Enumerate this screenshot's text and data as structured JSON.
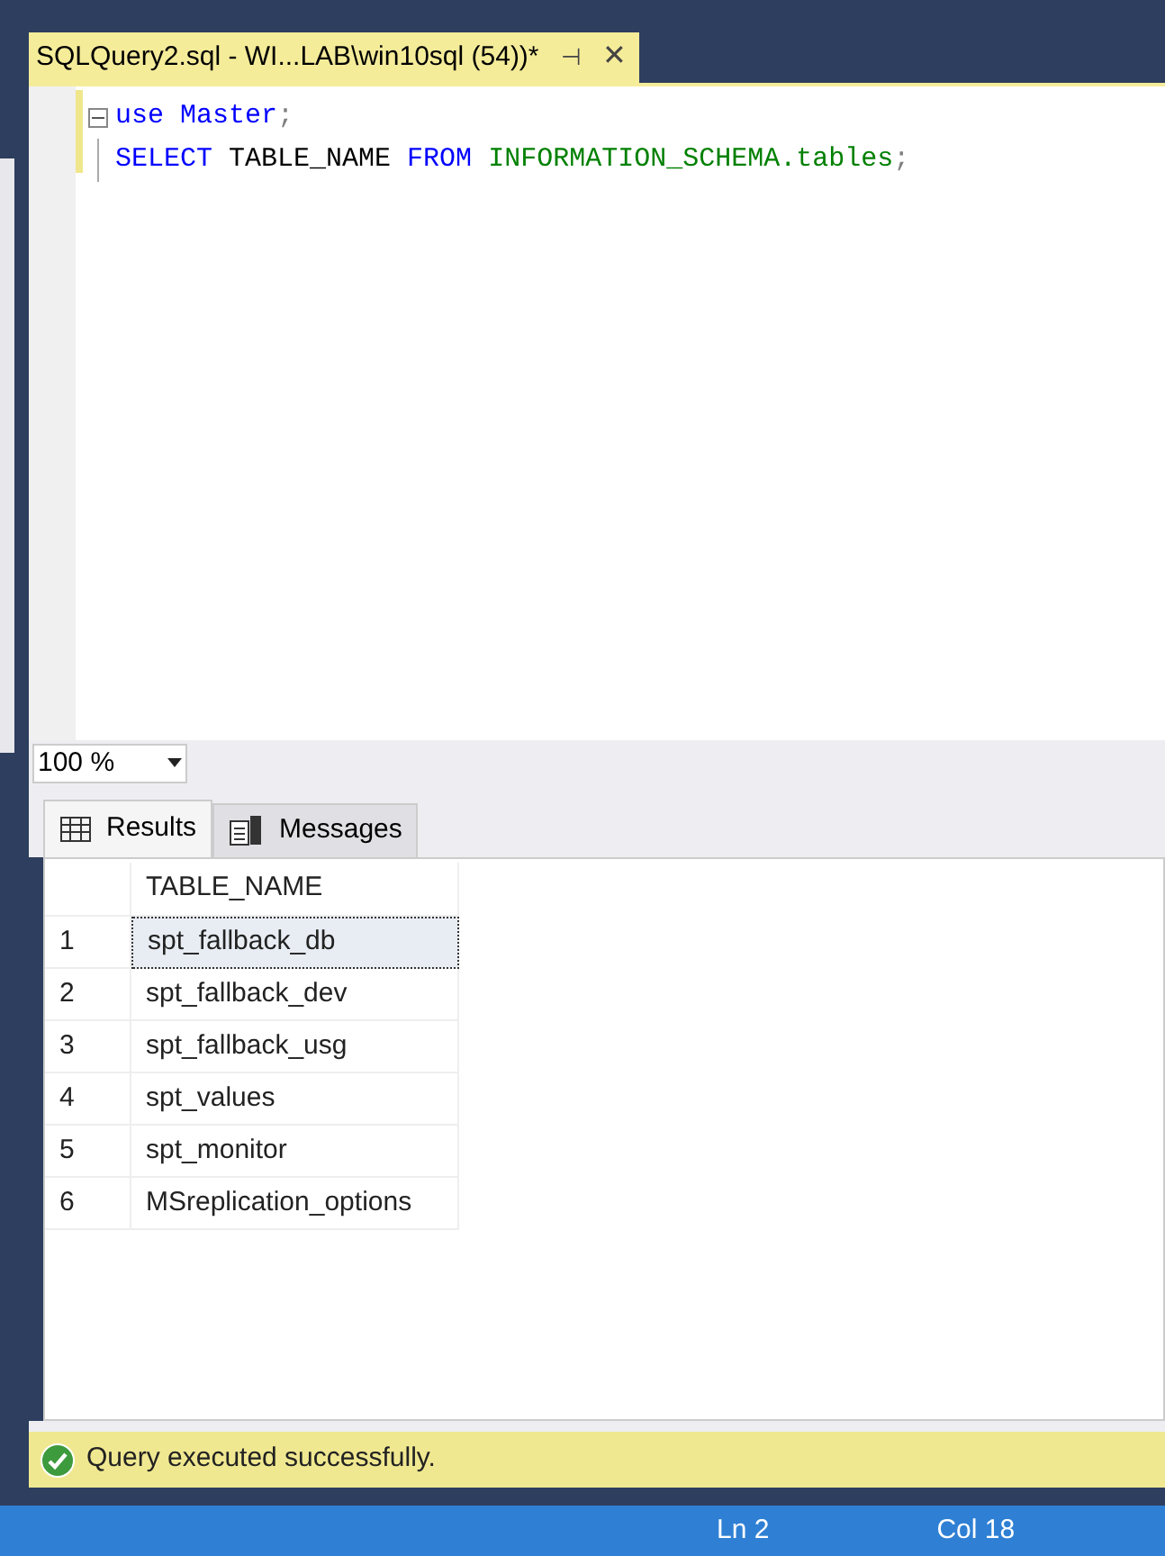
{
  "tab": {
    "title": "SQLQuery2.sql - WI...LAB\\win10sql (54))*",
    "pin": "⊣",
    "close": "✕"
  },
  "code_lines": [
    {
      "foldable": true,
      "tokens": [
        {
          "kind": "keyword",
          "text": "use"
        },
        {
          "kind": "keyword",
          "text": " Master"
        },
        {
          "kind": "punct",
          "text": ";"
        }
      ]
    },
    {
      "foldable": false,
      "tokens": [
        {
          "kind": "keyword",
          "text": "SELECT"
        },
        {
          "kind": "plain",
          "text": " TABLE_NAME "
        },
        {
          "kind": "keyword",
          "text": "FROM"
        },
        {
          "kind": "system",
          "text": " INFORMATION_SCHEMA.tables"
        },
        {
          "kind": "punct",
          "text": ";"
        }
      ]
    }
  ],
  "zoom": "100 %",
  "result_tabs": [
    {
      "label": "Results",
      "kind": "grid",
      "selected": true
    },
    {
      "label": "Messages",
      "kind": "messages",
      "selected": false
    }
  ],
  "table": {
    "columns": [
      "TABLE_NAME"
    ],
    "rows": [
      {
        "number": "1",
        "cells": [
          "spt_fallback_db"
        ],
        "selected": true
      },
      {
        "number": "2",
        "cells": [
          "spt_fallback_dev"
        ],
        "selected": false
      },
      {
        "number": "3",
        "cells": [
          "spt_fallback_usg"
        ],
        "selected": false
      },
      {
        "number": "4",
        "cells": [
          "spt_values"
        ],
        "selected": false
      },
      {
        "number": "5",
        "cells": [
          "spt_monitor"
        ],
        "selected": false
      },
      {
        "number": "6",
        "cells": [
          "MSreplication_options"
        ],
        "selected": false
      }
    ]
  },
  "query_status": "Query executed successfully.",
  "status_bar": {
    "line": "Ln 2",
    "column": "Col 18"
  }
}
